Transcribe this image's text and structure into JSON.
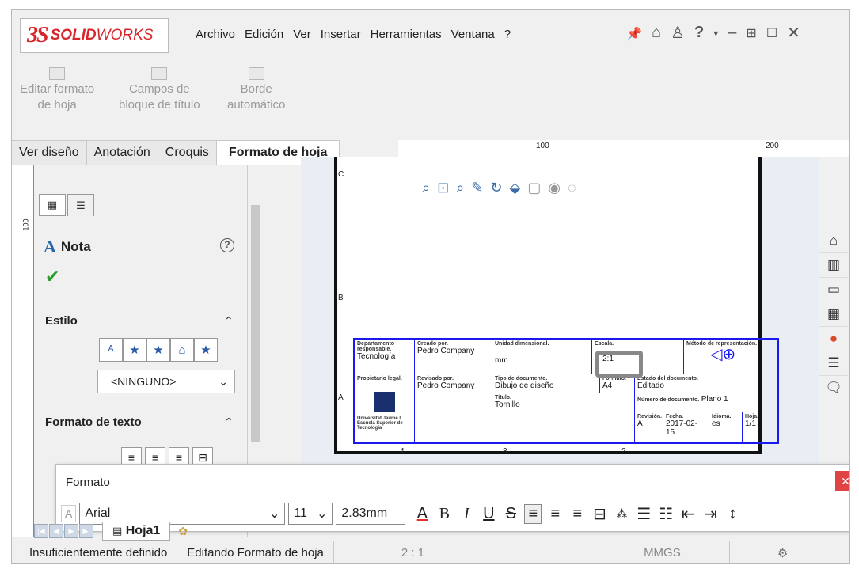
{
  "app": {
    "brand_ds": "3S",
    "brand_solid": "SOLID",
    "brand_works": "WORKS"
  },
  "menu": [
    "Archivo",
    "Edición",
    "Ver",
    "Insertar",
    "Herramientas",
    "Ventana",
    "?"
  ],
  "ribbon": {
    "buttons": [
      {
        "line1": "Editar formato",
        "line2": "de hoja",
        "icon": "sheet-format-icon"
      },
      {
        "line1": "Campos de",
        "line2": "bloque de título",
        "icon": "title-block-fields-icon"
      },
      {
        "line1": "Borde",
        "line2": "automático",
        "icon": "auto-border-icon"
      }
    ]
  },
  "tabs": [
    {
      "label": "Ver diseño",
      "active": false
    },
    {
      "label": "Anotación",
      "active": false
    },
    {
      "label": "Croquis",
      "active": false
    },
    {
      "label": "Formato de hoja",
      "active": true
    }
  ],
  "ruler": {
    "top_ticks": [
      "100",
      "200"
    ],
    "left_ticks": [
      "100"
    ]
  },
  "property_manager": {
    "title": "Nota",
    "sections": {
      "style": "Estilo",
      "text_format": "Formato de texto"
    },
    "style_dropdown": "<NINGUNO>"
  },
  "title_block": {
    "departamento_label": "Departamento responsable.",
    "departamento_value": "Tecnología",
    "creado_label": "Creado por.",
    "creado_value": "Pedro Company",
    "unidad_label": "Unidad dimensional.",
    "unidad_value": "mm",
    "escala_label": "Escala.",
    "escala_value": "2:1",
    "metodo_label": "Método de representación.",
    "propietario_label": "Propietario legal.",
    "revisado_label": "Revisado por.",
    "revisado_value": "Pedro Company",
    "tipo_label": "Tipo de documento.",
    "tipo_value": "Dibujo de diseño",
    "formato_label": "Formato.",
    "formato_value": "A4",
    "estado_label": "Estado del documento.",
    "estado_value": "Editado",
    "titulo_label": "Título.",
    "titulo_value": "Tornillo",
    "numero_label": "Número de documento.",
    "numero_value": "Plano 1",
    "revision_label": "Revisión.",
    "revision_value": "A",
    "fecha_label": "Fecha.",
    "fecha_value": "2017-02-15",
    "idioma_label": "Idioma.",
    "idioma_value": "es",
    "hoja_label": "Hoja.",
    "hoja_value": "1/1",
    "uni_label": "Universitat Jaume I",
    "escuela_label": "Escuela Superior de Tecnología"
  },
  "border_labels": {
    "rows": [
      "C",
      "B",
      "A"
    ],
    "cols": [
      "4",
      "3",
      "2"
    ]
  },
  "format_panel": {
    "title": "Formato",
    "font": "Arial",
    "size": "11",
    "height": "2.83mm"
  },
  "sheet_tab": "Hoja1",
  "status": {
    "s1": "Insuficientemente definido",
    "s2": "Editando Formato de hoja",
    "scale": "2 : 1",
    "units": "MMGS"
  }
}
